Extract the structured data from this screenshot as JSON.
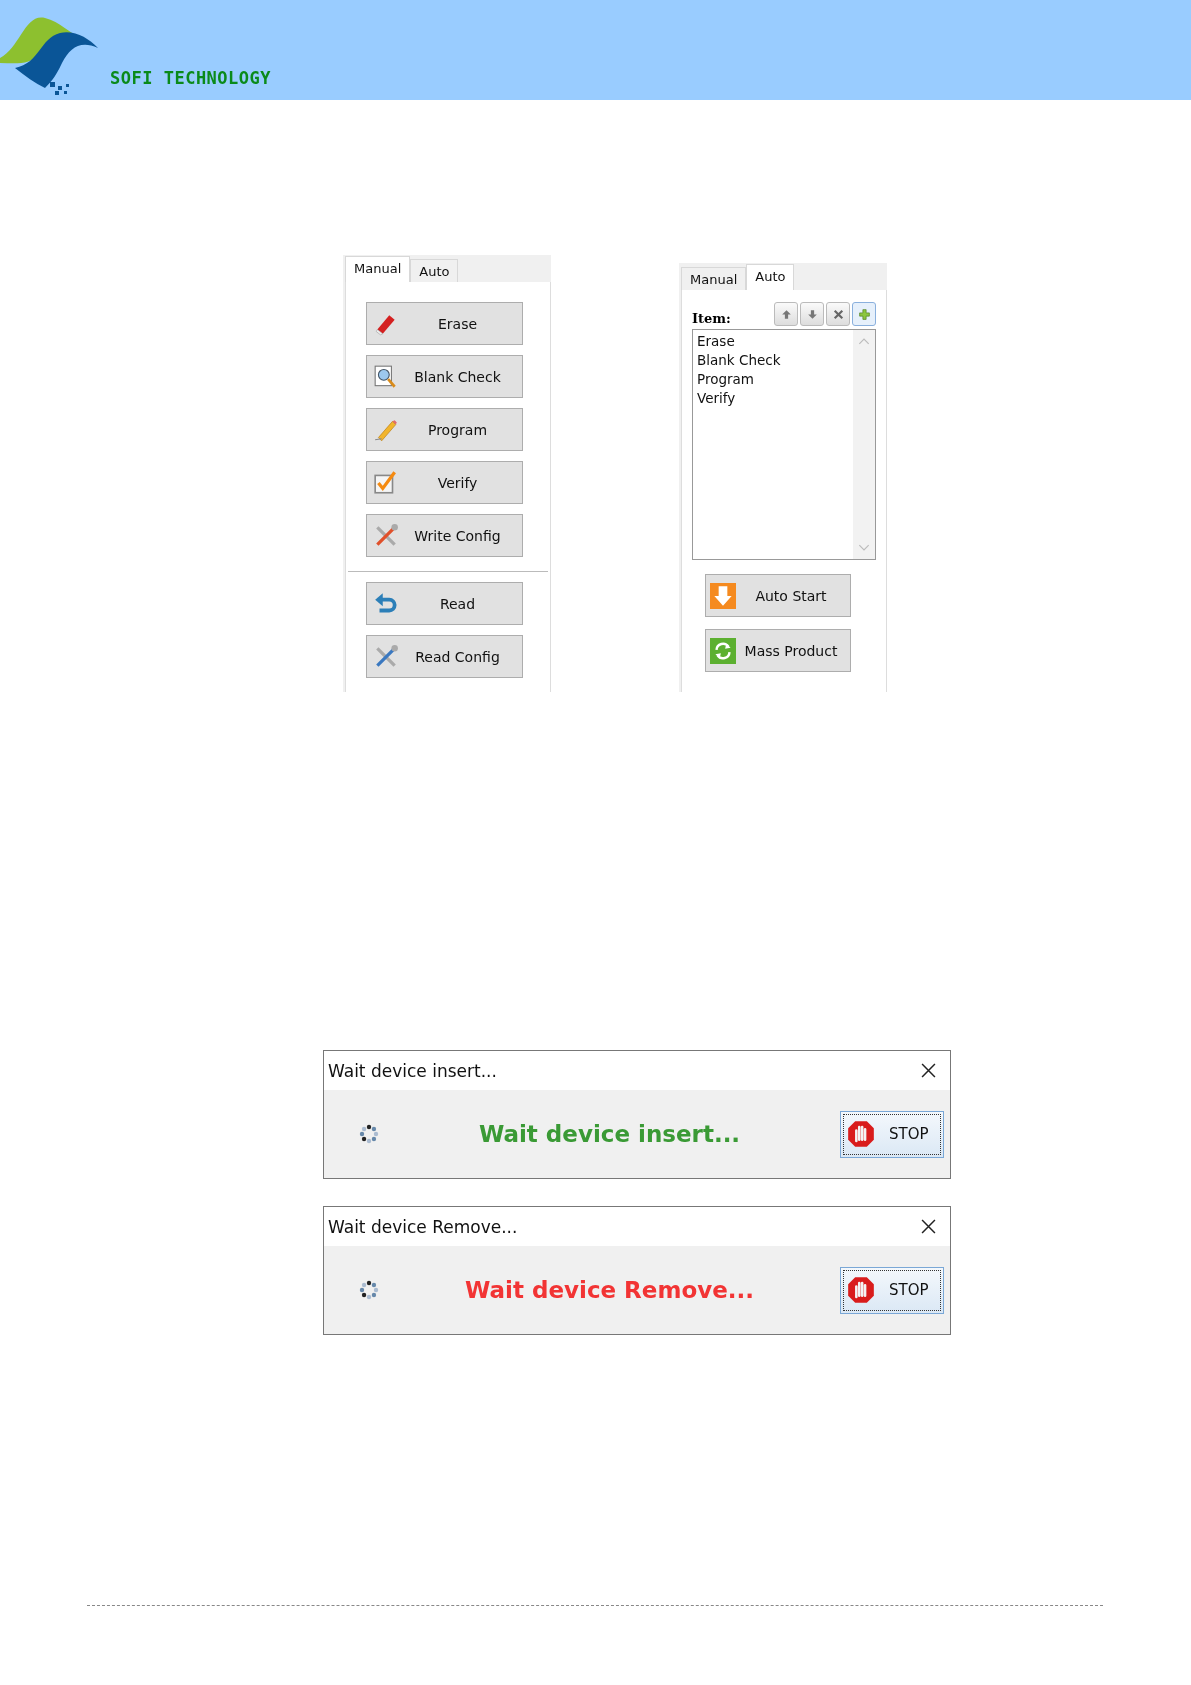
{
  "header": {
    "brand": "SOFI TECHNOLOGY"
  },
  "manual_panel": {
    "tabs": [
      {
        "label": "Manual",
        "selected": true
      },
      {
        "label": "Auto",
        "selected": false
      }
    ],
    "groups": [
      [
        {
          "label": "Erase",
          "kind": "erase"
        },
        {
          "label": "Blank Check",
          "kind": "blank"
        },
        {
          "label": "Program",
          "kind": "program"
        },
        {
          "label": "Verify",
          "kind": "verify"
        },
        {
          "label": "Write Config",
          "kind": "config"
        }
      ],
      [
        {
          "label": "Read",
          "kind": "read"
        },
        {
          "label": "Read Config",
          "kind": "config"
        }
      ]
    ]
  },
  "auto_panel": {
    "tabs": [
      {
        "label": "Manual",
        "selected": false
      },
      {
        "label": "Auto",
        "selected": true
      }
    ],
    "item_label": "Item:",
    "toolbar": [
      {
        "kind": "up"
      },
      {
        "kind": "down"
      },
      {
        "kind": "delete"
      },
      {
        "kind": "add"
      }
    ],
    "items": [
      "Erase",
      "Blank Check",
      "Program",
      "Verify"
    ],
    "buttons": [
      {
        "label": "Auto Start",
        "kind": "start"
      },
      {
        "label": "Mass Product",
        "kind": "mass"
      }
    ]
  },
  "dialogs": [
    {
      "title": "Wait device insert...",
      "message": "Wait device insert...",
      "color": "#3a9a35",
      "button": "STOP"
    },
    {
      "title": "Wait device Remove...",
      "message": "Wait device Remove...",
      "color": "#f23434",
      "button": "STOP"
    }
  ]
}
